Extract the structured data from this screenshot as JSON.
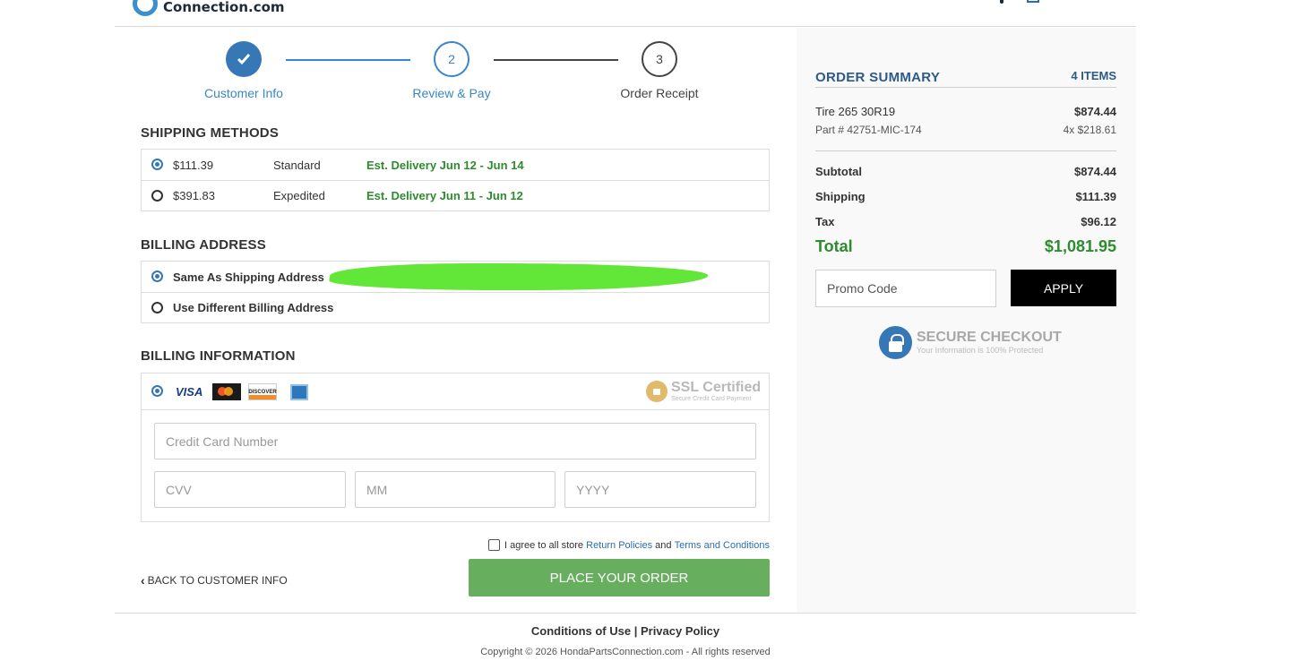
{
  "header": {
    "logo_text": "Connection.com"
  },
  "steps": [
    {
      "label": "Customer Info",
      "state": "done"
    },
    {
      "number": "2",
      "label": "Review & Pay",
      "state": "active"
    },
    {
      "number": "3",
      "label": "Order Receipt",
      "state": "pending"
    }
  ],
  "shipping": {
    "title": "SHIPPING METHODS",
    "options": [
      {
        "price": "$111.39",
        "name": "Standard",
        "estimate": "Est. Delivery Jun 12 - Jun 14",
        "selected": true
      },
      {
        "price": "$391.83",
        "name": "Expedited",
        "estimate": "Est. Delivery Jun 11 - Jun 12",
        "selected": false
      }
    ]
  },
  "billing_address": {
    "title": "BILLING ADDRESS",
    "options": [
      {
        "label": "Same As Shipping Address",
        "selected": true
      },
      {
        "label": "Use Different Billing Address",
        "selected": false
      }
    ]
  },
  "billing_info": {
    "title": "BILLING INFORMATION",
    "cards": [
      "VISA",
      "mastercard",
      "DISCOVER",
      "amex"
    ],
    "ssl_title": "SSL Certified",
    "ssl_sub": "Secure Credit Card Payment",
    "card_number_placeholder": "Credit Card Number",
    "cvv_placeholder": "CVV",
    "mm_placeholder": "MM",
    "yyyy_placeholder": "YYYY"
  },
  "agreement": {
    "prefix": "I agree to all store",
    "link1": "Return Policies",
    "and": "and",
    "link2": "Terms and Conditions",
    "checked": false
  },
  "actions": {
    "back_label": "BACK TO CUSTOMER INFO",
    "place_order_label": "PLACE YOUR ORDER"
  },
  "summary": {
    "title": "ORDER SUMMARY",
    "count": "4 ITEMS",
    "item_name": "Tire 265 30R19",
    "item_total": "$874.44",
    "item_part": "Part # 42751-MIC-174",
    "item_qty_price": "4x $218.61",
    "subtotal_label": "Subtotal",
    "subtotal": "$874.44",
    "shipping_label": "Shipping",
    "shipping": "$111.39",
    "tax_label": "Tax",
    "tax": "$96.12",
    "total_label": "Total",
    "total": "$1,081.95",
    "promo_placeholder": "Promo Code",
    "apply_label": "APPLY",
    "secure_title": "SECURE CHECKOUT",
    "secure_sub": "Your Information is 100% Protected"
  },
  "footer": {
    "conditions": "Conditions of Use",
    "separator": "|",
    "privacy": "Privacy Policy",
    "copyright": "Copyright © 2026 HondaPartsConnection.com - All rights reserved"
  },
  "colors": {
    "primary_blue": "#3677b6",
    "accent_green": "#2e8b2e",
    "button_green": "#67af5f"
  }
}
